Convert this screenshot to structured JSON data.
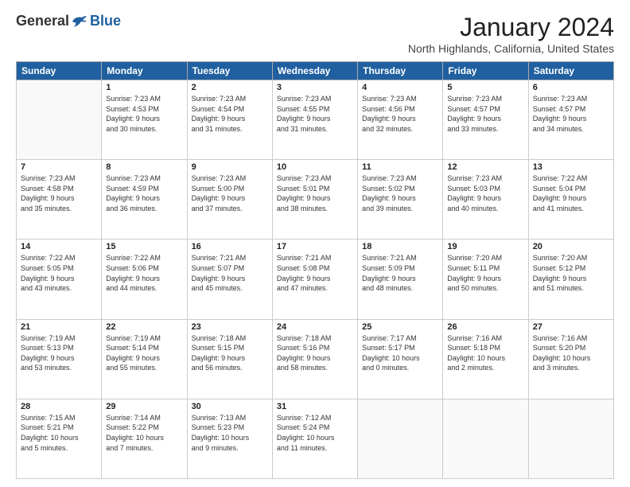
{
  "logo": {
    "general": "General",
    "blue": "Blue"
  },
  "header": {
    "month": "January 2024",
    "location": "North Highlands, California, United States"
  },
  "weekdays": [
    "Sunday",
    "Monday",
    "Tuesday",
    "Wednesday",
    "Thursday",
    "Friday",
    "Saturday"
  ],
  "weeks": [
    [
      {
        "day": "",
        "info": ""
      },
      {
        "day": "1",
        "info": "Sunrise: 7:23 AM\nSunset: 4:53 PM\nDaylight: 9 hours\nand 30 minutes."
      },
      {
        "day": "2",
        "info": "Sunrise: 7:23 AM\nSunset: 4:54 PM\nDaylight: 9 hours\nand 31 minutes."
      },
      {
        "day": "3",
        "info": "Sunrise: 7:23 AM\nSunset: 4:55 PM\nDaylight: 9 hours\nand 31 minutes."
      },
      {
        "day": "4",
        "info": "Sunrise: 7:23 AM\nSunset: 4:56 PM\nDaylight: 9 hours\nand 32 minutes."
      },
      {
        "day": "5",
        "info": "Sunrise: 7:23 AM\nSunset: 4:57 PM\nDaylight: 9 hours\nand 33 minutes."
      },
      {
        "day": "6",
        "info": "Sunrise: 7:23 AM\nSunset: 4:57 PM\nDaylight: 9 hours\nand 34 minutes."
      }
    ],
    [
      {
        "day": "7",
        "info": "Sunrise: 7:23 AM\nSunset: 4:58 PM\nDaylight: 9 hours\nand 35 minutes."
      },
      {
        "day": "8",
        "info": "Sunrise: 7:23 AM\nSunset: 4:59 PM\nDaylight: 9 hours\nand 36 minutes."
      },
      {
        "day": "9",
        "info": "Sunrise: 7:23 AM\nSunset: 5:00 PM\nDaylight: 9 hours\nand 37 minutes."
      },
      {
        "day": "10",
        "info": "Sunrise: 7:23 AM\nSunset: 5:01 PM\nDaylight: 9 hours\nand 38 minutes."
      },
      {
        "day": "11",
        "info": "Sunrise: 7:23 AM\nSunset: 5:02 PM\nDaylight: 9 hours\nand 39 minutes."
      },
      {
        "day": "12",
        "info": "Sunrise: 7:23 AM\nSunset: 5:03 PM\nDaylight: 9 hours\nand 40 minutes."
      },
      {
        "day": "13",
        "info": "Sunrise: 7:22 AM\nSunset: 5:04 PM\nDaylight: 9 hours\nand 41 minutes."
      }
    ],
    [
      {
        "day": "14",
        "info": "Sunrise: 7:22 AM\nSunset: 5:05 PM\nDaylight: 9 hours\nand 43 minutes."
      },
      {
        "day": "15",
        "info": "Sunrise: 7:22 AM\nSunset: 5:06 PM\nDaylight: 9 hours\nand 44 minutes."
      },
      {
        "day": "16",
        "info": "Sunrise: 7:21 AM\nSunset: 5:07 PM\nDaylight: 9 hours\nand 45 minutes."
      },
      {
        "day": "17",
        "info": "Sunrise: 7:21 AM\nSunset: 5:08 PM\nDaylight: 9 hours\nand 47 minutes."
      },
      {
        "day": "18",
        "info": "Sunrise: 7:21 AM\nSunset: 5:09 PM\nDaylight: 9 hours\nand 48 minutes."
      },
      {
        "day": "19",
        "info": "Sunrise: 7:20 AM\nSunset: 5:11 PM\nDaylight: 9 hours\nand 50 minutes."
      },
      {
        "day": "20",
        "info": "Sunrise: 7:20 AM\nSunset: 5:12 PM\nDaylight: 9 hours\nand 51 minutes."
      }
    ],
    [
      {
        "day": "21",
        "info": "Sunrise: 7:19 AM\nSunset: 5:13 PM\nDaylight: 9 hours\nand 53 minutes."
      },
      {
        "day": "22",
        "info": "Sunrise: 7:19 AM\nSunset: 5:14 PM\nDaylight: 9 hours\nand 55 minutes."
      },
      {
        "day": "23",
        "info": "Sunrise: 7:18 AM\nSunset: 5:15 PM\nDaylight: 9 hours\nand 56 minutes."
      },
      {
        "day": "24",
        "info": "Sunrise: 7:18 AM\nSunset: 5:16 PM\nDaylight: 9 hours\nand 58 minutes."
      },
      {
        "day": "25",
        "info": "Sunrise: 7:17 AM\nSunset: 5:17 PM\nDaylight: 10 hours\nand 0 minutes."
      },
      {
        "day": "26",
        "info": "Sunrise: 7:16 AM\nSunset: 5:18 PM\nDaylight: 10 hours\nand 2 minutes."
      },
      {
        "day": "27",
        "info": "Sunrise: 7:16 AM\nSunset: 5:20 PM\nDaylight: 10 hours\nand 3 minutes."
      }
    ],
    [
      {
        "day": "28",
        "info": "Sunrise: 7:15 AM\nSunset: 5:21 PM\nDaylight: 10 hours\nand 5 minutes."
      },
      {
        "day": "29",
        "info": "Sunrise: 7:14 AM\nSunset: 5:22 PM\nDaylight: 10 hours\nand 7 minutes."
      },
      {
        "day": "30",
        "info": "Sunrise: 7:13 AM\nSunset: 5:23 PM\nDaylight: 10 hours\nand 9 minutes."
      },
      {
        "day": "31",
        "info": "Sunrise: 7:12 AM\nSunset: 5:24 PM\nDaylight: 10 hours\nand 11 minutes."
      },
      {
        "day": "",
        "info": ""
      },
      {
        "day": "",
        "info": ""
      },
      {
        "day": "",
        "info": ""
      }
    ]
  ]
}
